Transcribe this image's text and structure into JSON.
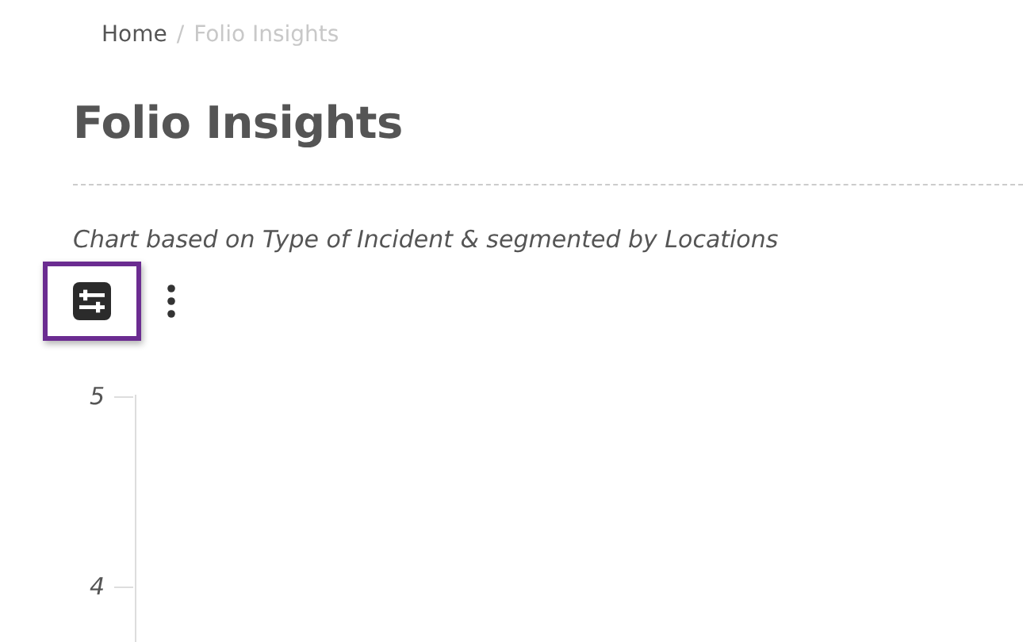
{
  "breadcrumb": [
    {
      "label": "Home",
      "current": false
    },
    {
      "label": "Folio Insights",
      "current": true
    }
  ],
  "breadcrumb_separator": "/",
  "title": "Folio Insights",
  "subtitle": "Chart based on Type of Incident & segmented by Locations",
  "toolbar": {
    "filter_button": {
      "focused": true
    }
  },
  "chart": {
    "y_ticks": [
      "5",
      "4"
    ]
  }
}
